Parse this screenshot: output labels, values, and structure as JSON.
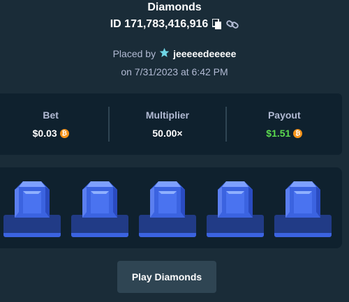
{
  "header": {
    "game_title": "Diamonds",
    "bet_id": "ID 171,783,416,916",
    "copy_icon": "copy-icon",
    "link_icon": "link-icon"
  },
  "placed": {
    "prefix": "Placed by",
    "user_icon": "star-badge-icon",
    "username": "jeeeeedeeeee",
    "date": "on 7/31/2023 at 6:42 PM"
  },
  "stats": {
    "bet_label": "Bet",
    "bet_value": "$0.03",
    "multiplier_label": "Multiplier",
    "multiplier_value": "50.00×",
    "payout_label": "Payout",
    "payout_value": "$1.51",
    "currency_icon": "bitcoin-icon",
    "payout_color": "#5cdb4f"
  },
  "board": {
    "gems": [
      "blue-diamond",
      "blue-diamond",
      "blue-diamond",
      "blue-diamond",
      "blue-diamond"
    ]
  },
  "actions": {
    "play_label": "Play Diamonds"
  },
  "colors": {
    "background": "#1a2c38",
    "panel": "#0f212e",
    "button": "#2f4553",
    "gem": "#3b63e0"
  }
}
